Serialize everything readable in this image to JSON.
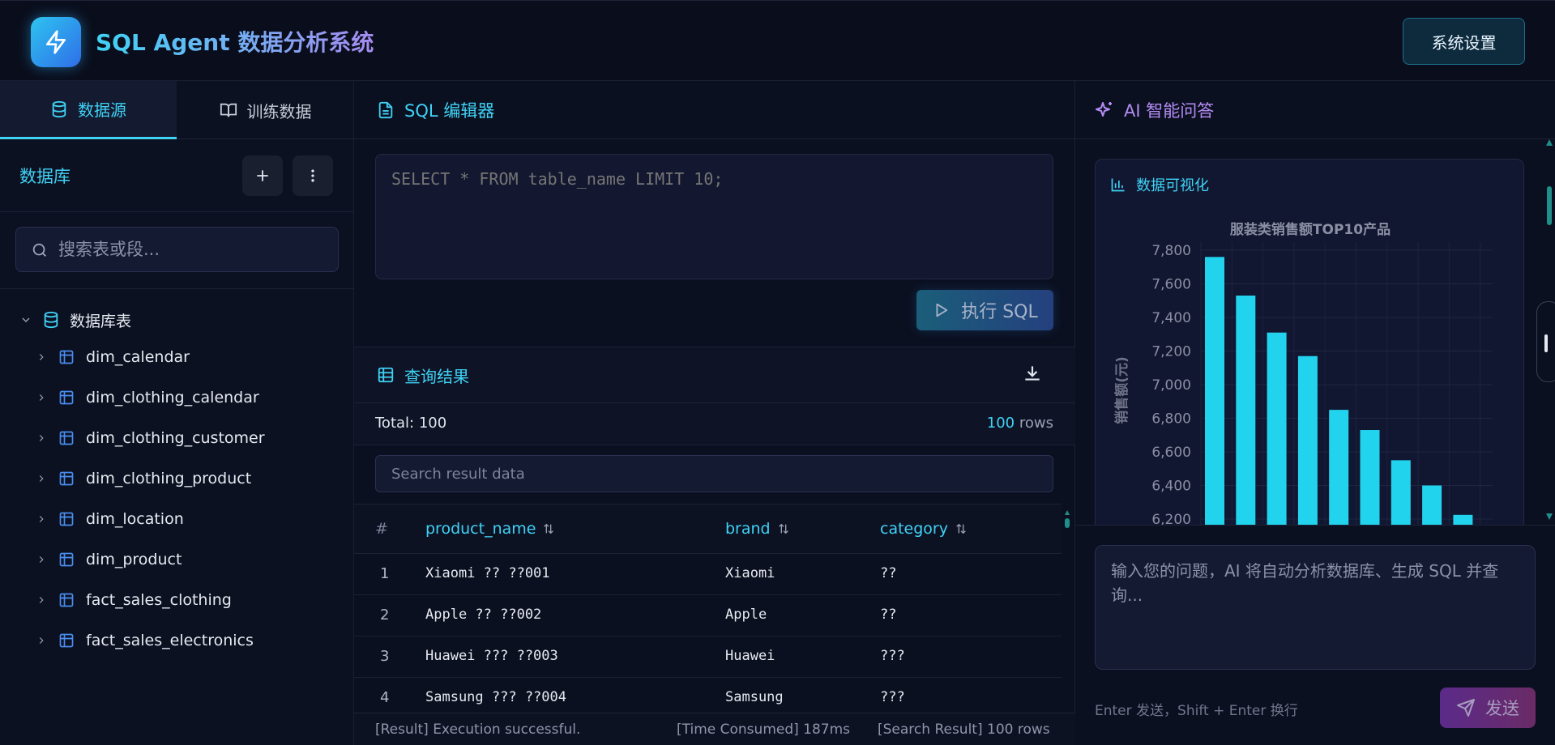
{
  "header": {
    "title": "SQL Agent 数据分析系统",
    "settings_label": "系统设置"
  },
  "left": {
    "tabs": [
      {
        "label": "数据源"
      },
      {
        "label": "训练数据"
      }
    ],
    "db_label": "数据库",
    "search_placeholder": "搜索表或段...",
    "tree_root": "数据库表",
    "tables": [
      "dim_calendar",
      "dim_clothing_calendar",
      "dim_clothing_customer",
      "dim_clothing_product",
      "dim_location",
      "dim_product",
      "fact_sales_clothing",
      "fact_sales_electronics"
    ]
  },
  "editor": {
    "title": "SQL 编辑器",
    "sql_placeholder": "SELECT * FROM table_name LIMIT 10;",
    "run_label": "执行 SQL"
  },
  "results": {
    "title": "查询结果",
    "total": "Total: 100",
    "rows_num": "100",
    "rows_word": "rows",
    "search_placeholder": "Search result data",
    "columns": [
      "#",
      "product_name",
      "brand",
      "category"
    ],
    "rows": [
      {
        "idx": "1",
        "product_name": "Xiaomi ?? ??001",
        "brand": "Xiaomi",
        "category": "??"
      },
      {
        "idx": "2",
        "product_name": "Apple ?? ??002",
        "brand": "Apple",
        "category": "??"
      },
      {
        "idx": "3",
        "product_name": "Huawei ??? ??003",
        "brand": "Huawei",
        "category": "???"
      },
      {
        "idx": "4",
        "product_name": "Samsung ??? ??004",
        "brand": "Samsung",
        "category": "???"
      }
    ],
    "status": {
      "result": "[Result] Execution successful.",
      "time": "[Time Consumed] 187ms",
      "search": "[Search Result] 100 rows"
    }
  },
  "ai": {
    "title": "AI 智能问答",
    "viz_title": "数据可视化",
    "chat_placeholder": "输入您的问题，AI 将自动分析数据库、生成 SQL 并查询...",
    "hint": "Enter 发送，Shift + Enter 换行",
    "send_label": "发送"
  },
  "chart_data": {
    "type": "bar",
    "title": "服装类销售额TOP10产品",
    "ylabel": "销售额(元)",
    "xlabel": "",
    "yticks": [
      7800,
      7600,
      7400,
      7200,
      7000,
      6800,
      6600,
      6400,
      6200
    ],
    "ylim": [
      6200,
      7800
    ],
    "values": [
      7760,
      7530,
      7310,
      7170,
      6850,
      6730,
      6550,
      6400,
      6225
    ],
    "grid": true,
    "color": "#22d3ee"
  },
  "colors": {
    "accent": "#3fd2f5",
    "ai_accent": "#b58cf5",
    "bg": "#0b0f1d"
  }
}
